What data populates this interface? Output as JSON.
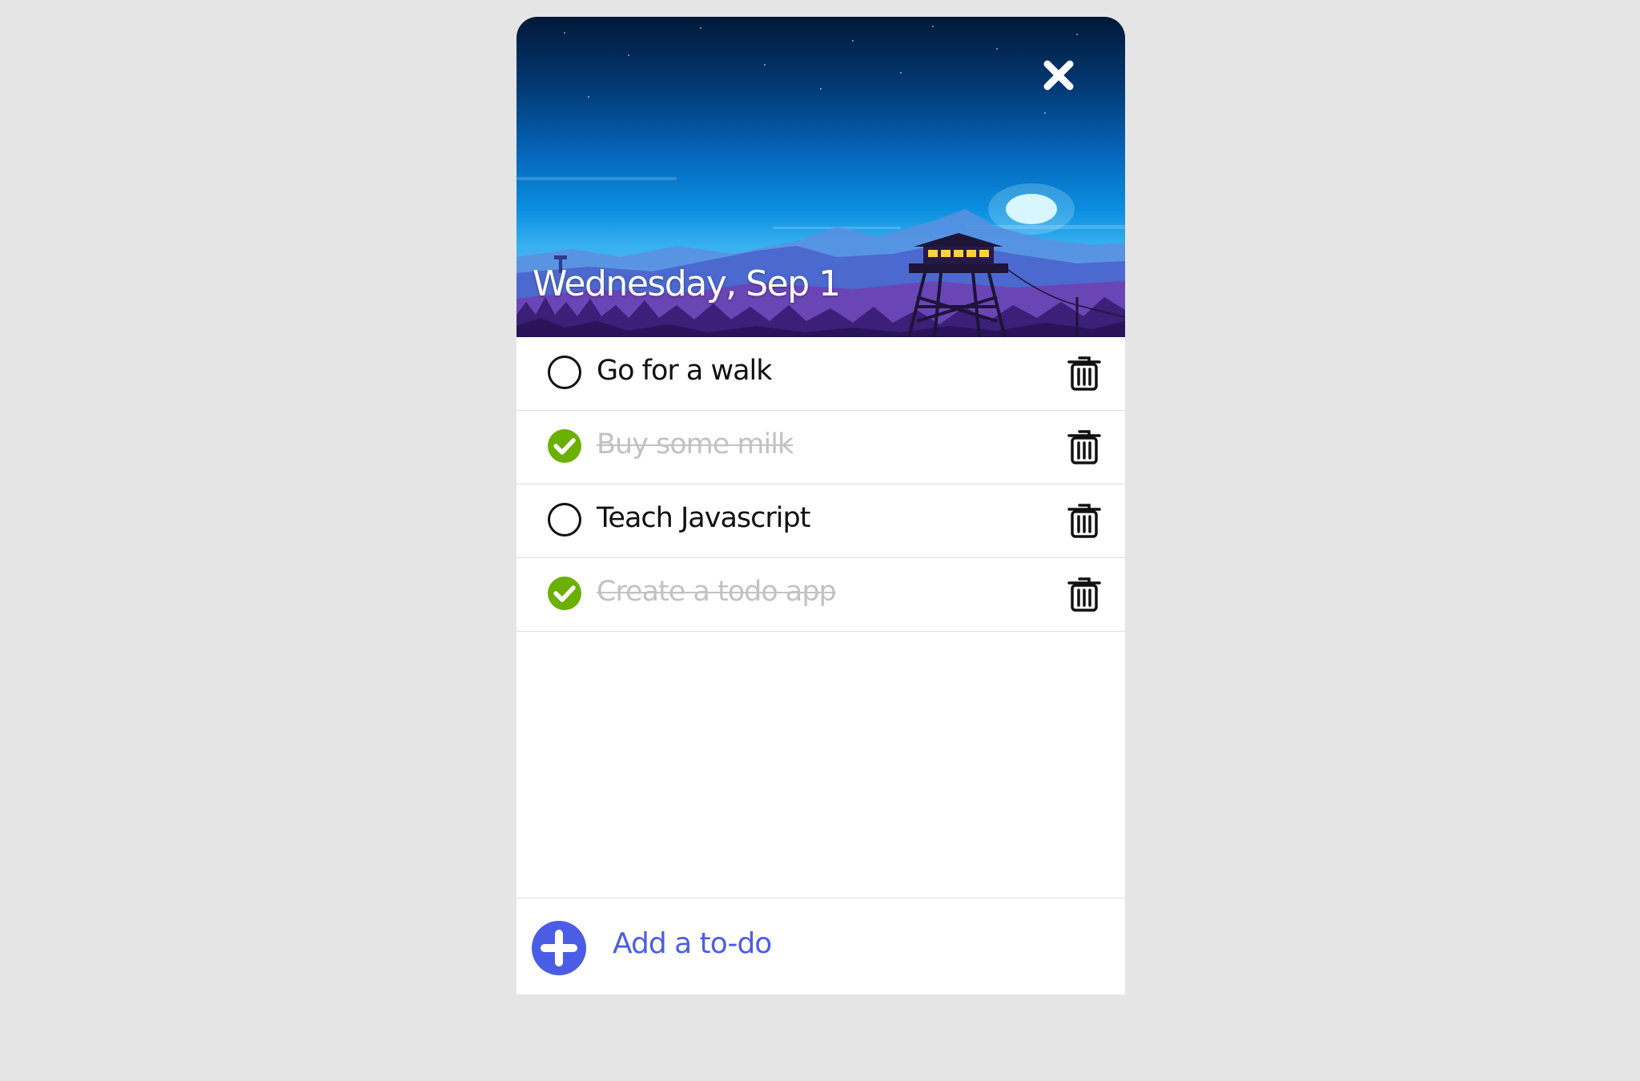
{
  "header": {
    "date_title": "Wednesday, Sep 1",
    "close_icon": "close-icon",
    "background_image": "night-mountain-fire-lookout-tower"
  },
  "todos": [
    {
      "text": "Go for a walk",
      "completed": false
    },
    {
      "text": "Buy some milk",
      "completed": true
    },
    {
      "text": "Teach Javascript",
      "completed": false
    },
    {
      "text": "Create a todo app",
      "completed": true
    }
  ],
  "footer": {
    "add_label": "Add a to-do",
    "add_icon": "plus-circle-icon"
  },
  "colors": {
    "page_background": "#e5e5e5",
    "accent_blue": "#4b5de4",
    "done_green": "#6bb000",
    "done_text": "#c2c2c2",
    "divider": "#dcdcdc"
  }
}
